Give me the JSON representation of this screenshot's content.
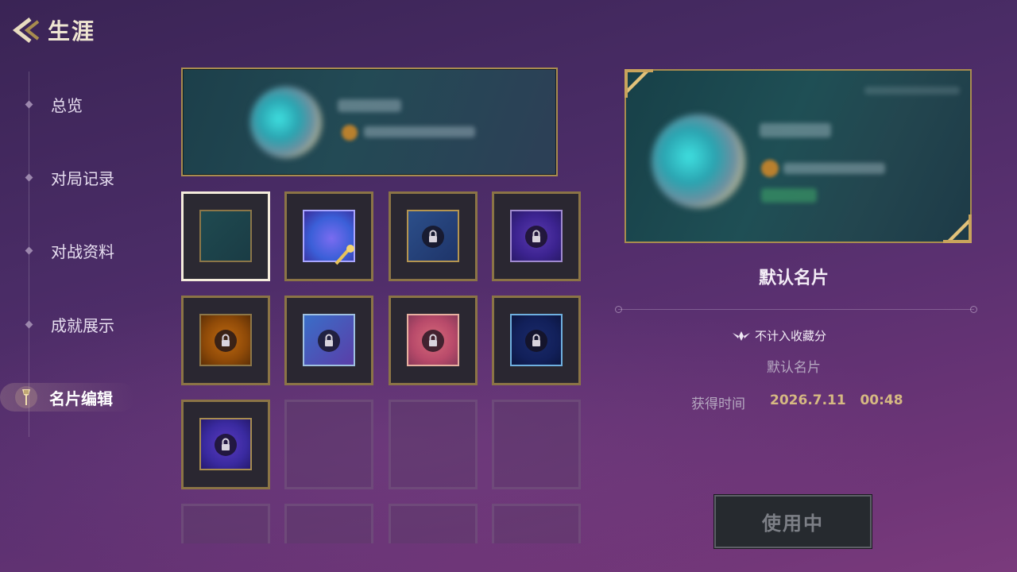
{
  "header": {
    "title": "生涯"
  },
  "sidebar": {
    "items": [
      {
        "label": "总览"
      },
      {
        "label": "对局记录"
      },
      {
        "label": "对战资料"
      },
      {
        "label": "成就展示"
      },
      {
        "label": "名片编辑"
      }
    ],
    "active_index": 4
  },
  "grid": {
    "tiles": [
      {
        "theme": "default-teal",
        "locked": false,
        "selected": true
      },
      {
        "theme": "cosmic-blue",
        "locked": false,
        "selected": false
      },
      {
        "theme": "navy-gold",
        "locked": true,
        "selected": false
      },
      {
        "theme": "violet-galaxy",
        "locked": true,
        "selected": false
      },
      {
        "theme": "amber",
        "locked": true,
        "selected": false
      },
      {
        "theme": "dragon-blue",
        "locked": true,
        "selected": false
      },
      {
        "theme": "pink-fox",
        "locked": true,
        "selected": false
      },
      {
        "theme": "dark-blue-swirl",
        "locked": true,
        "selected": false
      },
      {
        "theme": "purple-nebula",
        "locked": true,
        "selected": false
      }
    ],
    "empty_slots": 7
  },
  "detail": {
    "card_name": "默认名片",
    "collection_note": "不计入收藏分",
    "card_sub": "默认名片",
    "acquired_label": "获得时间",
    "acquired_value": "2026.7.11   00:48",
    "use_button": "使用中"
  },
  "colors": {
    "gold_border": "#a88c4f",
    "accent_gold_text": "#d6b982",
    "background_top": "#3a2455",
    "background_bottom": "#7a3a7c"
  }
}
